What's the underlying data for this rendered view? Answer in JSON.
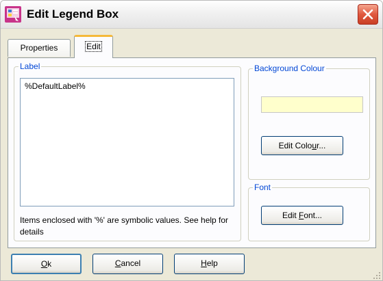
{
  "window": {
    "title": "Edit Legend Box"
  },
  "tabs": [
    {
      "label": "Properties",
      "active": false
    },
    {
      "label": "Edit",
      "active": true
    }
  ],
  "label_group": {
    "title": "Label",
    "value": "%DefaultLabel%",
    "hint": "Items enclosed with '%' are symbolic values. See help for details"
  },
  "background_group": {
    "title": "Background Colour",
    "swatch_color": "#ffffcc",
    "button_prefix": "Edit Colo",
    "button_accel": "u",
    "button_suffix": "r..."
  },
  "font_group": {
    "title": "Font",
    "button_prefix": "Edit ",
    "button_accel": "F",
    "button_suffix": "ont..."
  },
  "buttons": {
    "ok_accel": "O",
    "ok_rest": "k",
    "cancel_accel": "C",
    "cancel_rest": "ancel",
    "help_accel": "H",
    "help_rest": "elp"
  },
  "icons": {
    "app": "legend-app-icon",
    "close": "close-icon",
    "grip": "resize-grip-icon"
  }
}
